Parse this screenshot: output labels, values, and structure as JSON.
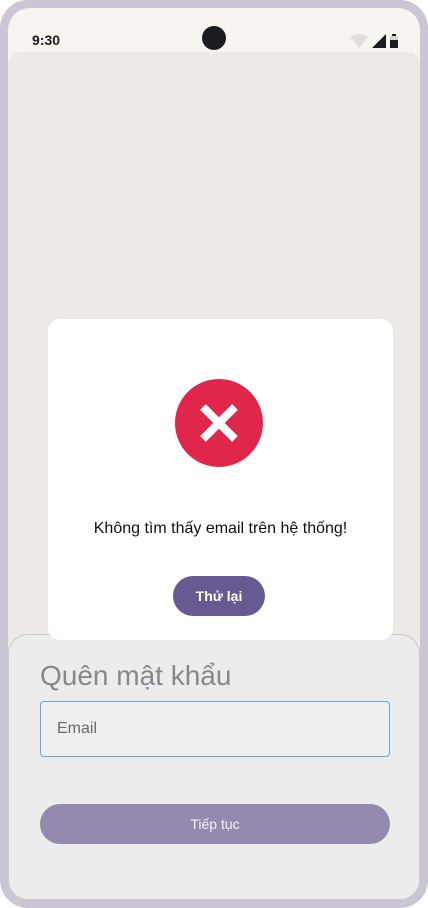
{
  "status_bar": {
    "time": "9:30"
  },
  "forgot_password": {
    "title": "Quên mật khẩu",
    "email_placeholder": "Email",
    "email_value": "",
    "continue_label": "Tiếp tục"
  },
  "error_dialog": {
    "icon": "error-x-circle-icon",
    "message": "Không tìm thấy email trên hệ thống!",
    "retry_label": "Thử lại"
  },
  "colors": {
    "error": "#e1264b",
    "primary": "#675a93",
    "primary_disabled": "#948aae",
    "field_border": "#6aa6d4"
  }
}
